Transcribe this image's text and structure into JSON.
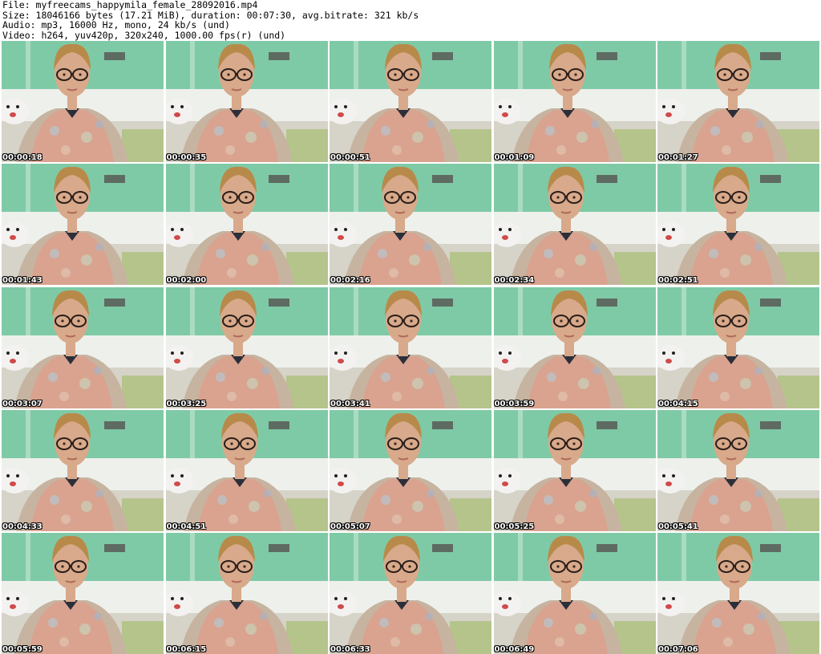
{
  "header": {
    "file_line": "File: myfreecams_happymila_female_28092016.mp4",
    "size_line": "Size: 18046166 bytes (17.21 MiB), duration: 00:07:30, avg.bitrate: 321 kb/s",
    "audio_line": "Audio: mp3, 16000 Hz, mono, 24 kb/s (und)",
    "video_line": "Video: h264, yuv420p, 320x240, 1000.00 fps(r) (und)"
  },
  "thumbnails": [
    {
      "timestamp": "00:00:18"
    },
    {
      "timestamp": "00:00:35"
    },
    {
      "timestamp": "00:00:51"
    },
    {
      "timestamp": "00:01:09"
    },
    {
      "timestamp": "00:01:27"
    },
    {
      "timestamp": "00:01:43"
    },
    {
      "timestamp": "00:02:00"
    },
    {
      "timestamp": "00:02:16"
    },
    {
      "timestamp": "00:02:34"
    },
    {
      "timestamp": "00:02:51"
    },
    {
      "timestamp": "00:03:07"
    },
    {
      "timestamp": "00:03:25"
    },
    {
      "timestamp": "00:03:41"
    },
    {
      "timestamp": "00:03:59"
    },
    {
      "timestamp": "00:04:15"
    },
    {
      "timestamp": "00:04:33"
    },
    {
      "timestamp": "00:04:51"
    },
    {
      "timestamp": "00:05:07"
    },
    {
      "timestamp": "00:05:25"
    },
    {
      "timestamp": "00:05:41"
    },
    {
      "timestamp": "00:05:59"
    },
    {
      "timestamp": "00:06:15"
    },
    {
      "timestamp": "00:06:33"
    },
    {
      "timestamp": "00:06:49"
    },
    {
      "timestamp": "00:07:06"
    }
  ],
  "colors": {
    "wall_green": "#7fcaa6",
    "wall_white": "#eef0ec",
    "top_shelf": "#5e6b62",
    "cushion": "#b5c48a",
    "cardigan": "#c6b4a0",
    "blouse": "#d9a38f",
    "skin": "#d8a98a",
    "hair": "#b88a4a",
    "plush_toy": "#f3f2f0",
    "glasses": "#2a1e1a"
  }
}
